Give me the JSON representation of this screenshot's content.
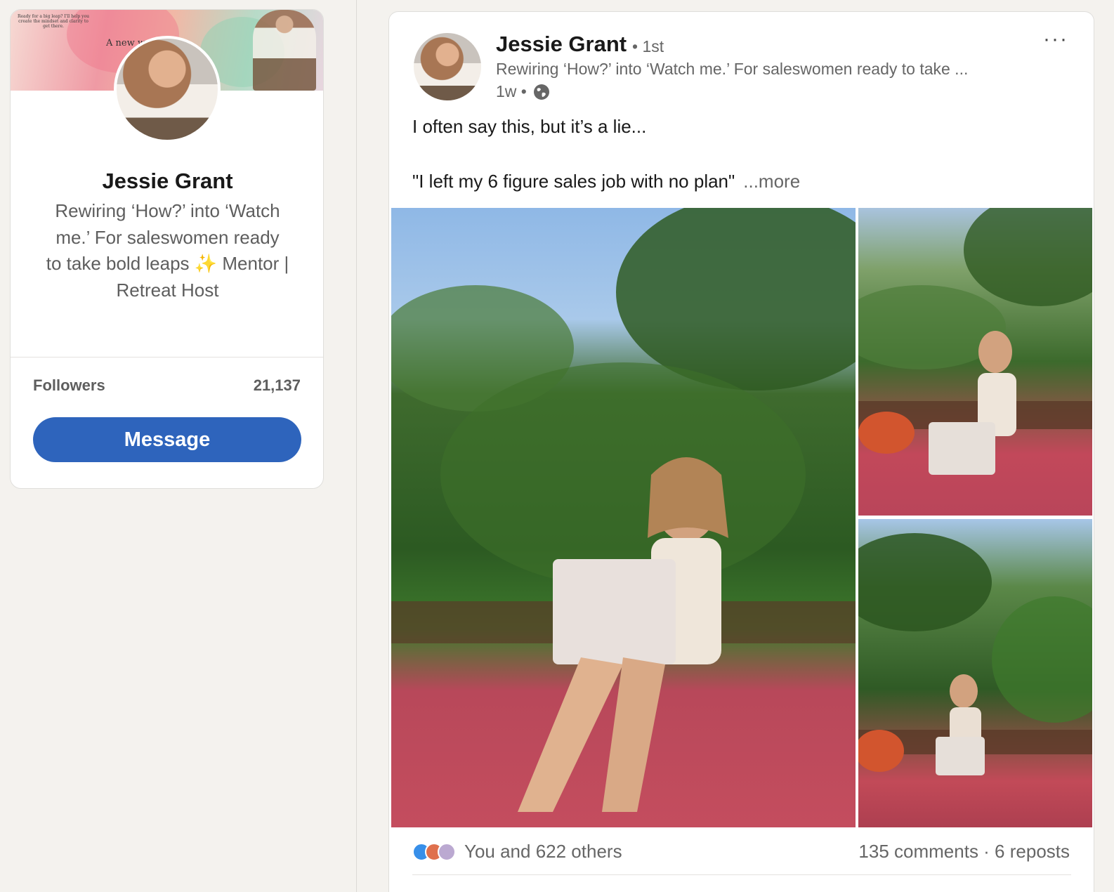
{
  "profile": {
    "banner_small_text": "Ready for a big leap? I'll help you create the mindset and clarity to get there.",
    "banner_tagline": "A new    waits",
    "name": "Jessie Grant",
    "headline": "Rewiring ‘How?’ into ‘Watch me.’ For saleswomen ready to take bold leaps ✨ Mentor | Retreat Host",
    "followers_label": "Followers",
    "followers_count": "21,137",
    "message_label": "Message"
  },
  "post": {
    "author_name": "Jessie Grant",
    "degree": "• 1st",
    "author_headline": "Rewiring ‘How?’ into ‘Watch me.’ For saleswomen ready to take ...",
    "time": "1w •",
    "more_menu": "···",
    "text_line1": "I often say this, but it’s a lie...",
    "text_line2": "\"I left my 6 figure sales job with no plan\"",
    "more_link": "...more",
    "reactions_text": "You and 622 others",
    "engagement_text": "135 comments · 6 reposts"
  },
  "colors": {
    "page_bg": "#f4f2ee",
    "card_bg": "#ffffff",
    "primary_button": "#2e64bc",
    "secondary_text": "#666666",
    "like": "#378fe9",
    "love": "#df704d",
    "support": "#bba9d1"
  },
  "icons": [
    "globe-icon",
    "more-menu-icon",
    "like-reaction-icon",
    "love-reaction-icon",
    "support-reaction-icon"
  ]
}
